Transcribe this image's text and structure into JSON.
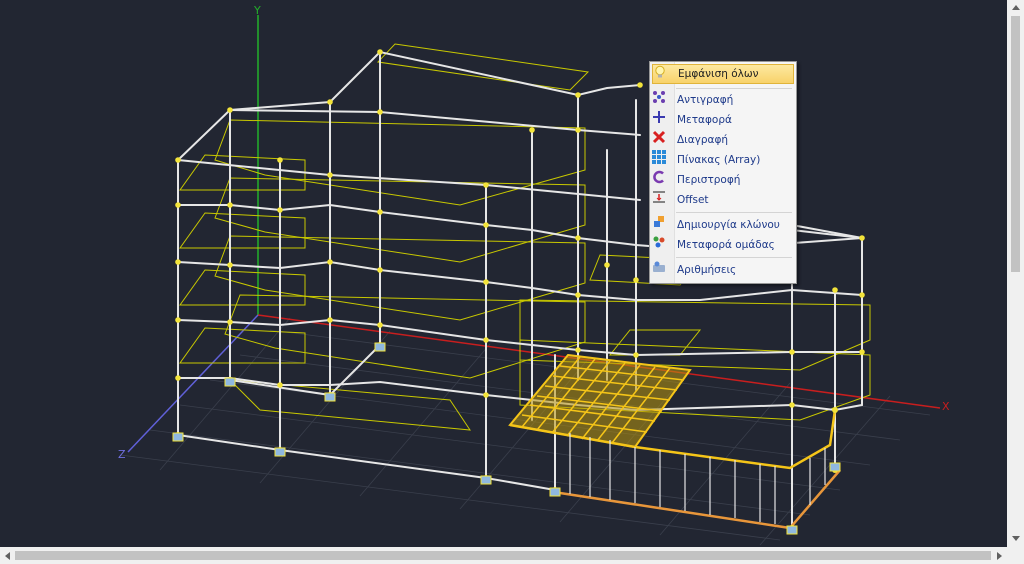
{
  "viewport": {
    "axis_labels": {
      "y": "Y",
      "x": "X",
      "z": "Z"
    },
    "colors": {
      "background": "#222632",
      "frame": "#e6e6e6",
      "slab_outline": "#c8c800",
      "node": "#f2e33a",
      "selection": "#f5c518",
      "x_axis": "#c81e1e",
      "y_axis": "#22b02a",
      "z_axis": "#6060d8",
      "foundation_beam": "#e8963a"
    }
  },
  "context_menu": {
    "items": [
      {
        "label": "Εμφάνιση όλων",
        "icon": "lightbulb-icon",
        "highlighted": true
      },
      {
        "label": "Αντιγραφή",
        "icon": "copy-icon"
      },
      {
        "label": "Μεταφορά",
        "icon": "move-icon"
      },
      {
        "label": "Διαγραφή",
        "icon": "delete-icon"
      },
      {
        "label": "Πίνακας (Array)",
        "icon": "array-icon"
      },
      {
        "label": "Περιστροφή",
        "icon": "rotate-icon"
      },
      {
        "label": "Offset",
        "icon": "offset-icon"
      },
      {
        "label": "Δημιουργία κλώνου",
        "icon": "clone-icon"
      },
      {
        "label": "Μεταφορά ομάδας",
        "icon": "group-move-icon"
      },
      {
        "label": "Αριθμήσεις",
        "icon": "numbering-icon"
      }
    ]
  }
}
